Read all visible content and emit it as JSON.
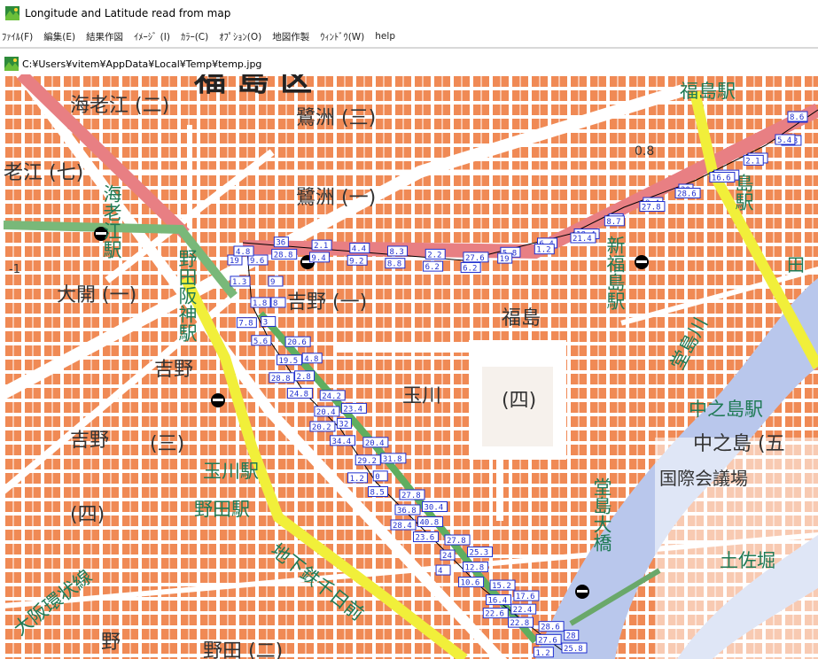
{
  "window": {
    "title": "Longitude and Latitude read from map"
  },
  "menu": {
    "items": [
      "ﾌｧｲﾙ(F)",
      "編集(E)",
      "結果作図",
      "ｲﾒｰｼﾞ (I)",
      "ｶﾗｰ(C)",
      "ｵﾌﾟｼｮﾝ(O)",
      "地図作製",
      "ｳｨﾝﾄﾞｳ(W)",
      "help"
    ]
  },
  "child_window": {
    "title": "C:¥Users¥vitem¥AppData¥Local¥Temp¥temp.jpg"
  },
  "map": {
    "colors": {
      "block": "#f08a55",
      "road": "#ffffff",
      "ground": "#f1e3d7",
      "river": "#b9c7ec",
      "rail_jr": "#e87f83",
      "rail_yellow": "#f1ef3a",
      "text_green": "#1f7a55",
      "marker_blue": "#1f2fd0"
    },
    "labels": {
      "town_ebie_ni": "海老江 (二)",
      "town_sagisu_san": "鷺洲 (三)",
      "town_sagisu_ichi": "鷺洲 (一)",
      "town_ebie_nana": "老江 (七)",
      "town_ohiraki": "大開 (一)",
      "town_yoshino_ichi": "吉野 (一)",
      "town_yoshino_v": "吉野",
      "town_yoshino_san": "(三)",
      "town_yoshino_2": "吉野",
      "town_yoshino_yon": "(四)",
      "town_tamagawa": "玉川",
      "town_fukushima": "福島",
      "town_fukushima_yon": "(四)",
      "town_nakanoshima": "中之島 (五",
      "town_noda_ni": "野田 (二)",
      "town_no": "野",
      "top_partial": "福 島 区",
      "elev": "0.8",
      "pl_minus1": "-1",
      "station_ebie": "海老江駅",
      "station_nodahanshin": "野田阪神駅",
      "station_fukushima_top": "福島駅",
      "station_shinfukushima": "新福島駅",
      "station_fukushima_right": "島駅",
      "station_tamagawa": "玉川駅",
      "station_noda": "野田駅",
      "station_nakanoshima": "中之島駅",
      "station_tosabori": "土佐堀",
      "river_dojima": "堂島川",
      "bridge_dojima": "堂島大橋",
      "hall": "国際会議場",
      "line_loop": "大阪環状線",
      "line_subway": "地下鉄千日前",
      "right_edge": "田"
    },
    "markers": [
      "19",
      "9.6",
      "9",
      "1.3",
      "1.8",
      "8",
      "7.8",
      "3",
      "20.6",
      "5.6",
      "19.5",
      "4.8",
      "28.8",
      "2.8",
      "24.2",
      "24.8",
      "20.4",
      "23.4",
      "20.2",
      "32",
      "20.4",
      "34.4",
      "29.2",
      "31.8",
      "1.2",
      "0",
      "27.8",
      "8.5",
      "36.8",
      "30.4",
      "28.4",
      "40.8",
      "27.8",
      "23.6",
      "24",
      "25.3",
      "4",
      "12.8",
      "15.2",
      "10.6",
      "16.4",
      "17.6",
      "22.6",
      "22.4",
      "28.6",
      "22.8",
      "27.6",
      "28",
      "1.2",
      "25.8",
      "4.8",
      "36",
      "28.8",
      "2.1",
      "9.4",
      "4.4",
      "9.2",
      "8.3",
      "8.8",
      "2.2",
      "6.2",
      "27.6",
      "6.2",
      "5.8",
      "19",
      "6.4",
      "1.2",
      "18.4",
      "21.4",
      "3",
      "8.7",
      "8.4",
      "27.8",
      "20",
      "28.6",
      "26.4",
      "16.6",
      "8.6",
      "2.1",
      "4.8",
      "5.4",
      "1.8",
      "8.6"
    ]
  }
}
